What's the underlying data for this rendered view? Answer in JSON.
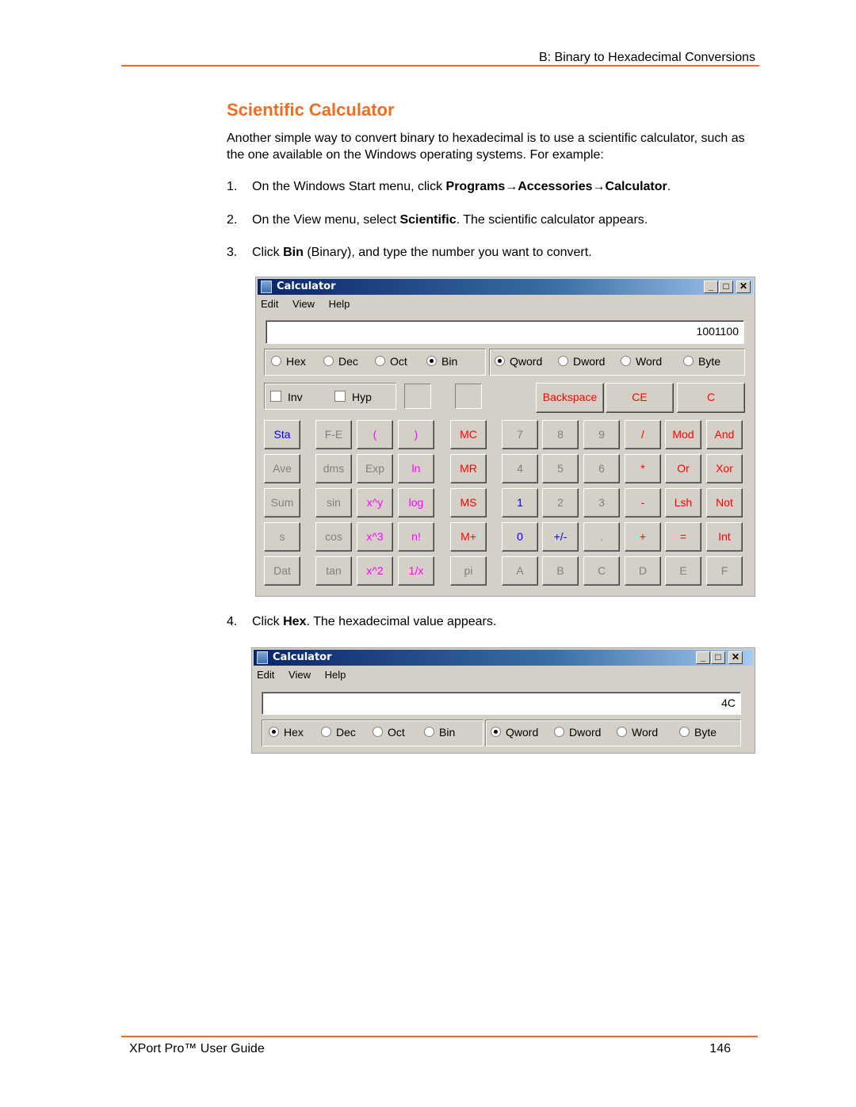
{
  "header": {
    "running_title": "B: Binary to Hexadecimal Conversions"
  },
  "section": {
    "title": "Scientific Calculator",
    "intro": "Another simple way to convert binary to hexadecimal is to use a scientific calculator, such as the one available on the Windows operating systems. For example:"
  },
  "steps": [
    {
      "num": "1.",
      "pre": "On the Windows Start menu, click ",
      "bold": "Programs→Accessories→Calculator",
      "post": "."
    },
    {
      "num": "2.",
      "pre": "On the View menu, select ",
      "bold": "Scientific",
      "post": ". The scientific calculator appears."
    },
    {
      "num": "3.",
      "pre": "Click ",
      "bold": "Bin",
      "post": " (Binary), and type the number you want to convert."
    },
    {
      "num": "4.",
      "pre": "Click ",
      "bold": "Hex",
      "post": ". The hexadecimal value appears."
    }
  ],
  "calc1": {
    "title": "Calculator",
    "menu": [
      "Edit",
      "View",
      "Help"
    ],
    "display": "1001100",
    "base_radios": [
      {
        "label": "Hex",
        "selected": false
      },
      {
        "label": "Dec",
        "selected": false
      },
      {
        "label": "Oct",
        "selected": false
      },
      {
        "label": "Bin",
        "selected": true
      }
    ],
    "size_radios": [
      {
        "label": "Qword",
        "selected": true
      },
      {
        "label": "Dword",
        "selected": false
      },
      {
        "label": "Word",
        "selected": false
      },
      {
        "label": "Byte",
        "selected": false
      }
    ],
    "checkboxes": [
      {
        "label": "Inv"
      },
      {
        "label": "Hyp"
      }
    ],
    "edit_keys": [
      {
        "label": "Backspace",
        "color": "red"
      },
      {
        "label": "CE",
        "color": "red"
      },
      {
        "label": "C",
        "color": "red"
      }
    ],
    "keys": [
      [
        {
          "label": "Sta",
          "color": "blue"
        },
        {
          "label": "F-E",
          "color": "gray"
        },
        {
          "label": "(",
          "color": "mag"
        },
        {
          "label": ")",
          "color": "mag"
        },
        {
          "label": "MC",
          "color": "red"
        },
        {
          "label": "7",
          "color": "gray"
        },
        {
          "label": "8",
          "color": "gray"
        },
        {
          "label": "9",
          "color": "gray"
        },
        {
          "label": "/",
          "color": "red"
        },
        {
          "label": "Mod",
          "color": "red"
        },
        {
          "label": "And",
          "color": "red"
        }
      ],
      [
        {
          "label": "Ave",
          "color": "gray"
        },
        {
          "label": "dms",
          "color": "gray"
        },
        {
          "label": "Exp",
          "color": "gray"
        },
        {
          "label": "ln",
          "color": "mag"
        },
        {
          "label": "MR",
          "color": "red"
        },
        {
          "label": "4",
          "color": "gray"
        },
        {
          "label": "5",
          "color": "gray"
        },
        {
          "label": "6",
          "color": "gray"
        },
        {
          "label": "*",
          "color": "red"
        },
        {
          "label": "Or",
          "color": "red"
        },
        {
          "label": "Xor",
          "color": "red"
        }
      ],
      [
        {
          "label": "Sum",
          "color": "gray"
        },
        {
          "label": "sin",
          "color": "gray"
        },
        {
          "label": "x^y",
          "color": "mag"
        },
        {
          "label": "log",
          "color": "mag"
        },
        {
          "label": "MS",
          "color": "red"
        },
        {
          "label": "1",
          "color": "blue"
        },
        {
          "label": "2",
          "color": "gray"
        },
        {
          "label": "3",
          "color": "gray"
        },
        {
          "label": "-",
          "color": "red"
        },
        {
          "label": "Lsh",
          "color": "red"
        },
        {
          "label": "Not",
          "color": "red"
        }
      ],
      [
        {
          "label": "s",
          "color": "gray"
        },
        {
          "label": "cos",
          "color": "gray"
        },
        {
          "label": "x^3",
          "color": "mag"
        },
        {
          "label": "n!",
          "color": "mag"
        },
        {
          "label": "M+",
          "color": "red"
        },
        {
          "label": "0",
          "color": "blue"
        },
        {
          "label": "+/-",
          "color": "blue"
        },
        {
          "label": ".",
          "color": "gray"
        },
        {
          "label": "+",
          "color": "red"
        },
        {
          "label": "=",
          "color": "red"
        },
        {
          "label": "Int",
          "color": "red"
        }
      ],
      [
        {
          "label": "Dat",
          "color": "gray"
        },
        {
          "label": "tan",
          "color": "gray"
        },
        {
          "label": "x^2",
          "color": "mag"
        },
        {
          "label": "1/x",
          "color": "mag"
        },
        {
          "label": "pi",
          "color": "gray"
        },
        {
          "label": "A",
          "color": "gray"
        },
        {
          "label": "B",
          "color": "gray"
        },
        {
          "label": "C",
          "color": "gray"
        },
        {
          "label": "D",
          "color": "gray"
        },
        {
          "label": "E",
          "color": "gray"
        },
        {
          "label": "F",
          "color": "gray"
        }
      ]
    ]
  },
  "calc2": {
    "title": "Calculator",
    "menu": [
      "Edit",
      "View",
      "Help"
    ],
    "display": "4C",
    "base_radios": [
      {
        "label": "Hex",
        "selected": true
      },
      {
        "label": "Dec",
        "selected": false
      },
      {
        "label": "Oct",
        "selected": false
      },
      {
        "label": "Bin",
        "selected": false
      }
    ],
    "size_radios": [
      {
        "label": "Qword",
        "selected": true
      },
      {
        "label": "Dword",
        "selected": false
      },
      {
        "label": "Word",
        "selected": false
      },
      {
        "label": "Byte",
        "selected": false
      }
    ]
  },
  "window_buttons": {
    "minimize": "_",
    "maximize": "□",
    "close": "✕"
  },
  "footer": {
    "doc_title": "XPort Pro™ User Guide",
    "page_number": "146"
  }
}
